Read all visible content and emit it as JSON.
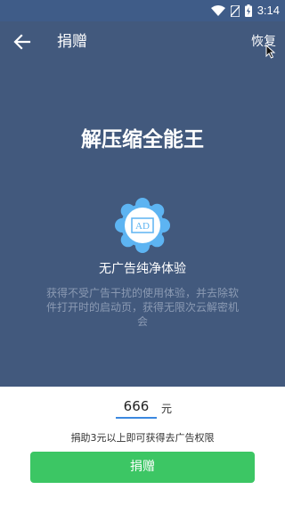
{
  "status_bar": {
    "time": "3:14"
  },
  "header": {
    "title": "捐赠",
    "restore_label": "恢复"
  },
  "hero": {
    "title": "解压缩全能王",
    "badge_text": "AD",
    "feature_title": "无广告纯净体验",
    "feature_desc": "获得不受广告干扰的使用体验，并去除软件打开时的启动页，获得无限次云解密机会"
  },
  "donation": {
    "amount": "666",
    "unit": "元",
    "hint": "捐助3元以上即可获得去广告权限",
    "button_label": "捐赠"
  },
  "colors": {
    "primary": "#42597d",
    "status_bar": "#3f5c88",
    "accent_green": "#3cc664",
    "input_underline": "#3b88e0",
    "badge_blue": "#5db4f2"
  }
}
